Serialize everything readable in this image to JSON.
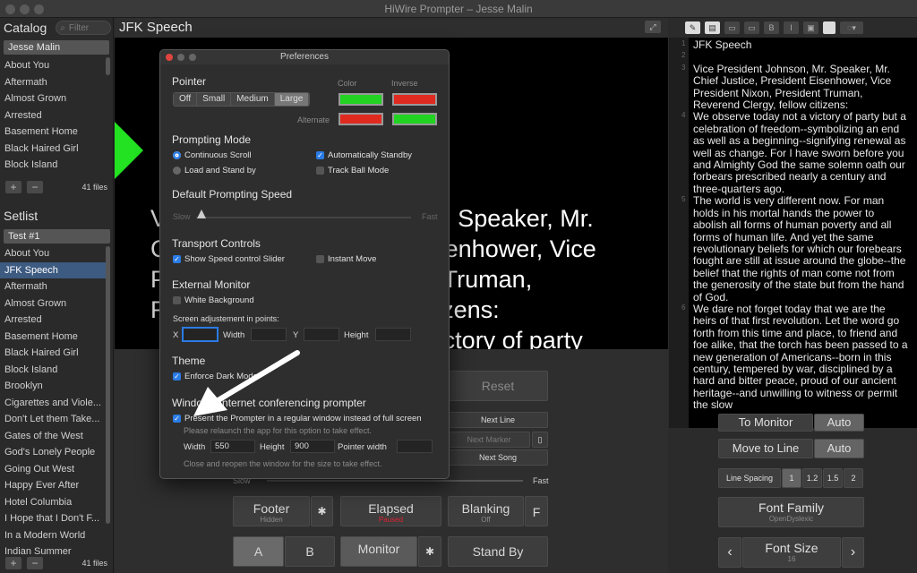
{
  "window": {
    "title": "HiWire Prompter – Jesse Malin"
  },
  "catalog": {
    "heading": "Catalog",
    "filter_placeholder": "Filter",
    "selected": "Jesse Malin",
    "items": [
      "About You",
      "Aftermath",
      "Almost Grown",
      "Arrested",
      "Basement Home",
      "Black Haired Girl",
      "Block Island"
    ],
    "count": "41 files"
  },
  "setlist": {
    "heading": "Setlist",
    "selected": "Test #1",
    "items": [
      "About You",
      "JFK Speech",
      "Aftermath",
      "Almost Grown",
      "Arrested",
      "Basement Home",
      "Black Haired Girl",
      "Block Island",
      "Brooklyn",
      "Cigarettes and Viole...",
      "Don't Let them Take...",
      "Gates of the West",
      "God's Lonely People",
      "Going Out West",
      "Happy Ever After",
      "Hotel Columbia",
      "I Hope that I Don't F...",
      "In a Modern World",
      "Indian Summer"
    ],
    "active_index": 1,
    "count": "41 files"
  },
  "center": {
    "title": "JFK Speech",
    "prompter_lines": [
      "Vice President Johnson, Mr. Speaker, Mr.",
      "Chief Justice, President Eisenhower, Vice",
      "President Nixon, President Truman,",
      "Reverend Clergy, fellow citizens:",
      "  We observe today not a victory of party"
    ],
    "pointer_color": "#22e222"
  },
  "controls": {
    "reset": "Reset",
    "next_line": "Next Line",
    "next_marker": "Next Marker",
    "next_song": "Next Song",
    "slow": "Slow",
    "fast": "Fast",
    "footer": {
      "label": "Footer",
      "sub": "Hidden"
    },
    "elapsed": {
      "label": "Elapsed",
      "sub": "Paused"
    },
    "blanking": {
      "label": "Blanking",
      "sub": "Off",
      "key": "F"
    },
    "a": "A",
    "b": "B",
    "monitor": "Monitor",
    "stand_by": "Stand By"
  },
  "preferences": {
    "title": "Preferences",
    "pointer": {
      "label": "Pointer",
      "sizes": [
        "Off",
        "Small",
        "Medium",
        "Large"
      ],
      "selected": "Large",
      "color_label": "Color",
      "inverse_label": "Inverse",
      "alternate_label": "Alternate",
      "color": "#22d322",
      "inverse": "#e02a20"
    },
    "prompting_mode": {
      "label": "Prompting Mode",
      "continuous": "Continuous Scroll",
      "load_stand": "Load and Stand by",
      "auto_standby": "Automatically Standby",
      "trackball": "Track Ball Mode"
    },
    "speed": {
      "label": "Default Prompting Speed",
      "slow": "Slow",
      "fast": "Fast"
    },
    "transport": {
      "label": "Transport Controls",
      "show_slider": "Show Speed control Slider",
      "instant_move": "Instant Move"
    },
    "external": {
      "label": "External Monitor",
      "white_bg": "White Background",
      "adjust": "Screen adjustement in points:",
      "x": "X",
      "width": "Width",
      "y": "Y",
      "height": "Height"
    },
    "theme": {
      "label": "Theme",
      "dark": "Enforce Dark Mode"
    },
    "window": {
      "label": "Window / Internet conferencing prompter",
      "present": "Present the Prompter in a regular window instead of full screen",
      "relaunch": "Please relaunch the app for this option to take effect.",
      "width_label": "Width",
      "width": "550",
      "height_label": "Height",
      "height": "900",
      "pointer_width_label": "Pointer width",
      "close_hint": "Close and reopen the window for the size to take effect."
    }
  },
  "script": {
    "lines": [
      {
        "n": "1",
        "text": "JFK Speech"
      },
      {
        "n": "2",
        "text": ""
      },
      {
        "n": "3",
        "text": "Vice President Johnson, Mr. Speaker, Mr. Chief Justice, President Eisenhower, Vice President Nixon, President Truman, Reverend Clergy, fellow citizens:"
      },
      {
        "n": "4",
        "text": "    We observe today not a victory of party but a celebration of freedom--symbolizing an end as well as a beginning--signifying renewal as well as change. For I have sworn before you and Almighty God the same solemn oath our forbears prescribed nearly a century and three-quarters ago."
      },
      {
        "n": "5",
        "text": "    The world is very different now. For man holds in his mortal hands the power to abolish all forms of human poverty and all forms of human life. And yet the same revolutionary beliefs for which our forebears fought are still at issue around the globe--the belief that the rights of man come not from the generosity of the state but from the hand of God."
      },
      {
        "n": "6",
        "text": "    We dare not forget today that we are the heirs of that first revolution. Let the word go forth from this time and place, to friend and foe alike, that the torch has been passed to a new generation of Americans--born in this century, tempered by war, disciplined by a hard and bitter peace, proud of our ancient heritage--and unwilling to witness or permit the slow"
      }
    ]
  },
  "right_controls": {
    "to_monitor": "To Monitor",
    "auto1": "Auto",
    "move_to_line": "Move to Line",
    "auto2": "Auto",
    "line_spacing": "Line Spacing",
    "spacings": [
      "1",
      "1.2",
      "1.5",
      "2"
    ],
    "font_family": "Font Family",
    "font_family_value": "OpenDyslexic",
    "font_size": "Font Size",
    "font_size_value": "16",
    "prev": "‹",
    "next": "›"
  }
}
